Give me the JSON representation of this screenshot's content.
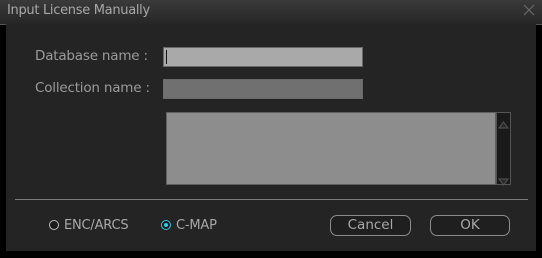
{
  "dialog": {
    "title": "Input License Manually",
    "close_icon": "close-icon"
  },
  "form": {
    "database_label": "Database name :",
    "database_value": "",
    "collection_label": "Collection name :",
    "collection_value": "",
    "license_text": ""
  },
  "options": {
    "enc_label": "ENC/ARCS",
    "cmap_label": "C-MAP",
    "selected": "C-MAP"
  },
  "buttons": {
    "cancel_label": "Cancel",
    "ok_label": "OK"
  },
  "colors": {
    "accent": "#39c6e6",
    "background": "#242424"
  }
}
